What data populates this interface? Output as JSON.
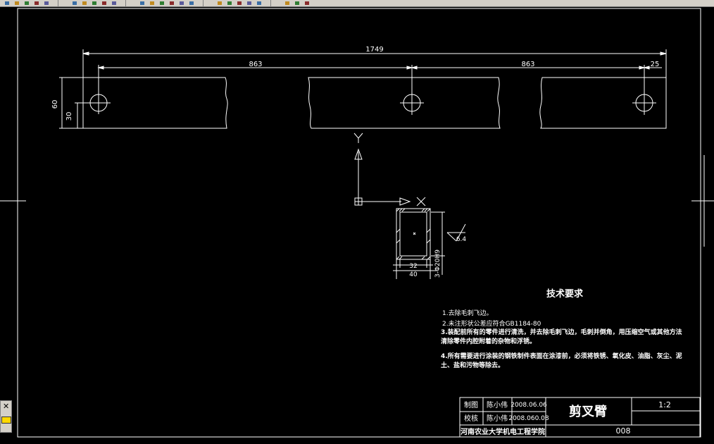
{
  "toolbar": {
    "buttons": [
      "new-icon",
      "open-icon",
      "save-icon",
      "print-icon",
      "preview-icon",
      "cut-icon",
      "copy-icon",
      "paste-icon",
      "match-icon",
      "undo-icon",
      "redo-icon",
      "pan-icon",
      "zoom-realtime-icon",
      "zoom-window-icon",
      "zoom-previous-icon",
      "properties-icon",
      "designcenter-icon",
      "toolpalette-icon",
      "sheetset-icon",
      "markup-icon",
      "calc-icon",
      "help-icon",
      "layer-icon",
      "layer-state-icon"
    ]
  },
  "drawing": {
    "dims": {
      "overall": "1749",
      "left_span": "863",
      "right_span": "863",
      "end_offset": "25",
      "height": "60",
      "half_height": "30",
      "section_height": "32",
      "section_width": "40",
      "hole_note": "3-Φ20H9",
      "roughness": "6.4"
    },
    "ucs": {
      "y_label": "Y",
      "x_label": "X"
    }
  },
  "tech_req": {
    "title": "技术要求",
    "items": [
      "1.去除毛刺飞边。",
      "2.未注形状公差应符合GB1184-80",
      "3.装配前所有的零件进行清洗，并去除毛刺飞边，毛刺并倒角，用压缩空气或其他方法清除零件内腔附着的杂物和浮锈。",
      "4.所有需要进行涂装的钢铁制件表面在涂漆前，必须将铁锈、氧化皮、油脂、灰尘、泥土、盐和污物等除去。"
    ]
  },
  "title_block": {
    "drawn_label": "制图",
    "drawn_name": "陈小伟",
    "drawn_date": "2008.06.06",
    "checked_label": "校核",
    "checked_name": "陈小伟",
    "checked_date": "2008.060.08",
    "part_name": "剪叉臂",
    "scale": "1:2",
    "institution": "河南农业大学机电工程学院",
    "drawing_no": "008"
  }
}
